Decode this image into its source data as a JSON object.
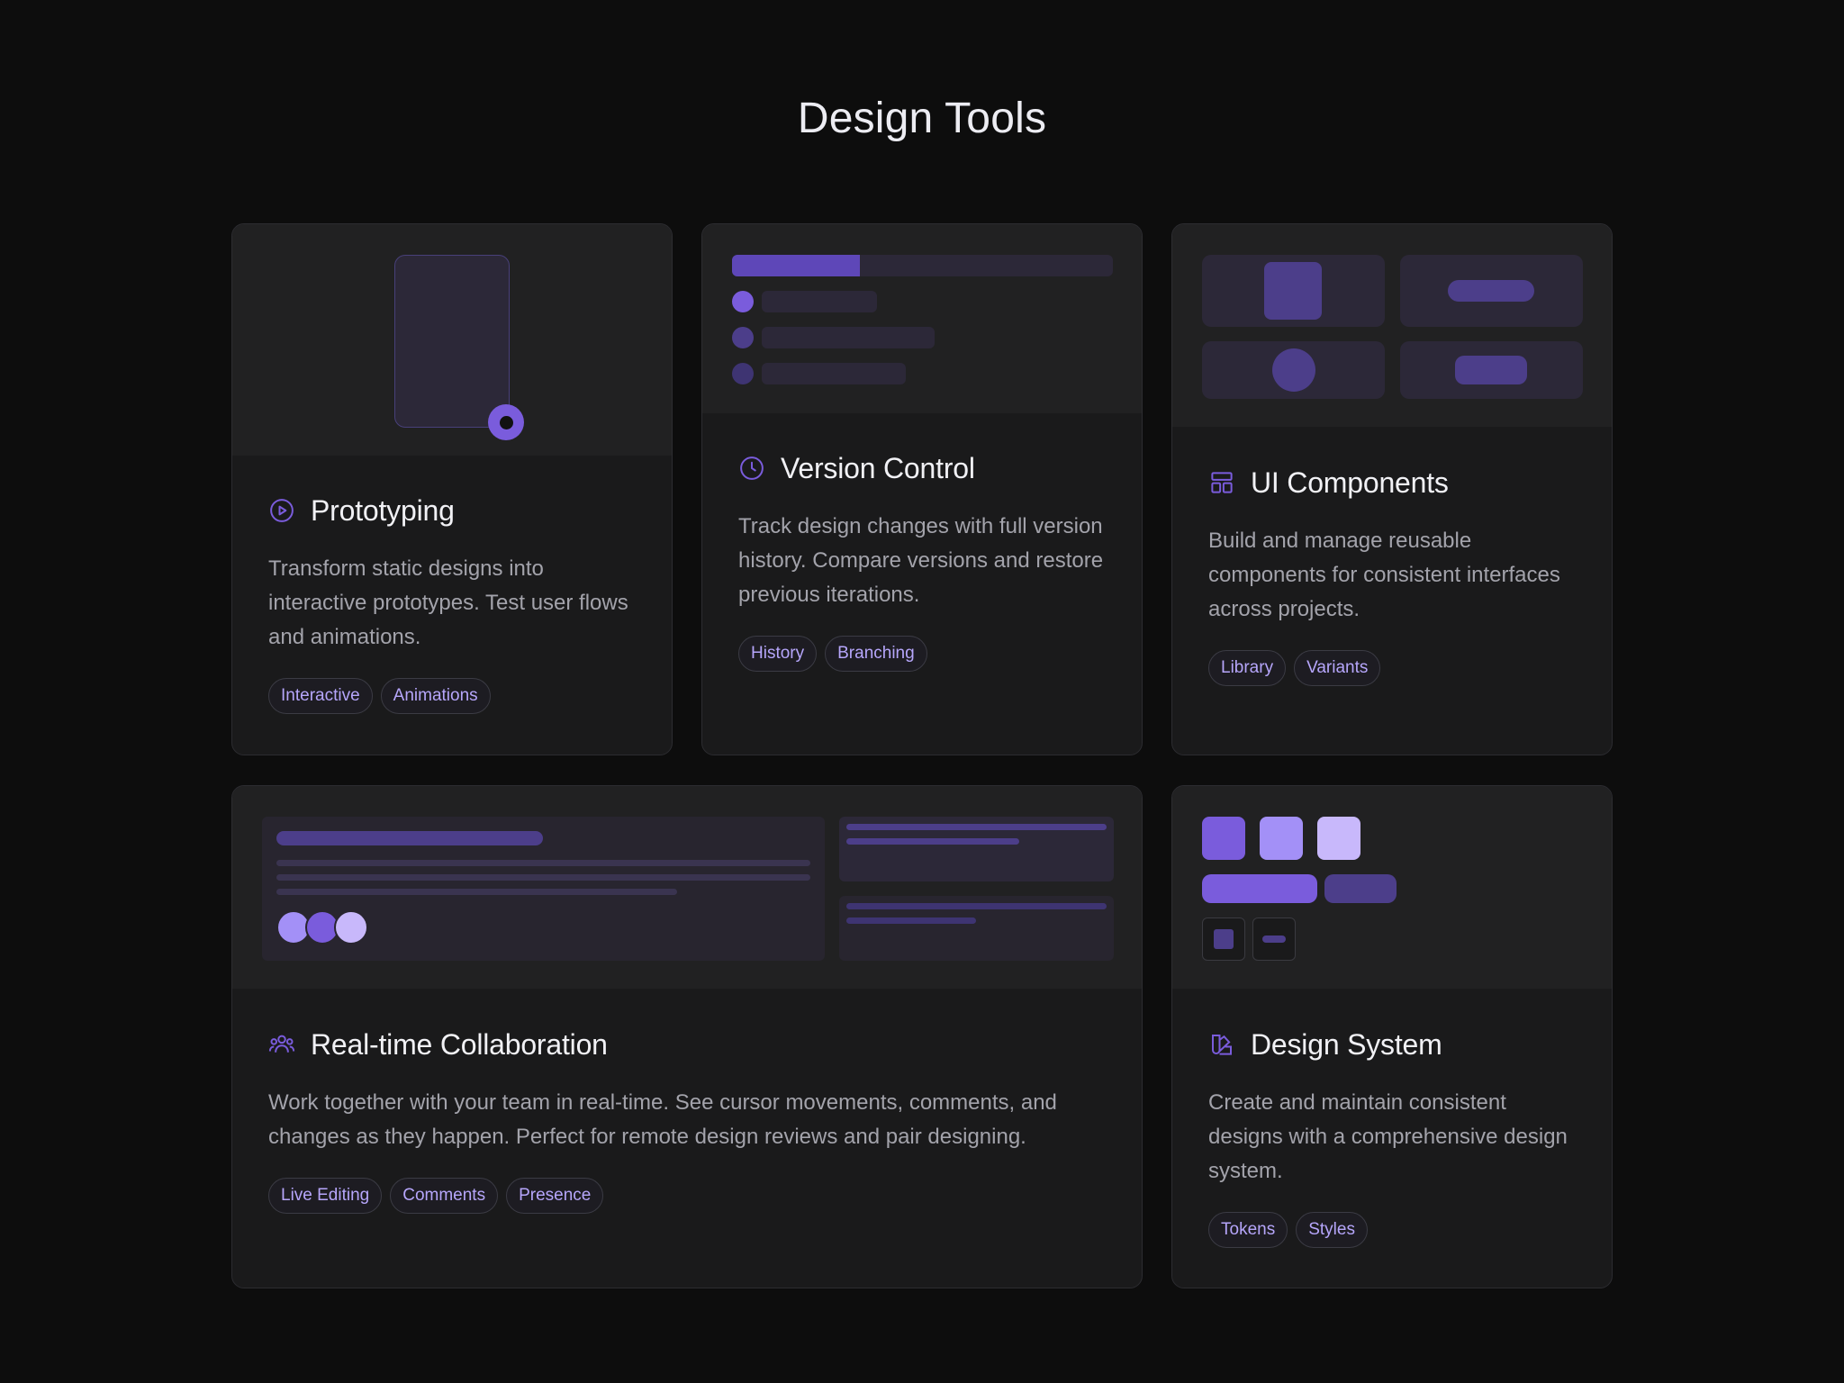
{
  "page": {
    "title": "Design Tools"
  },
  "colors": {
    "accent": "#7a5cdc",
    "accent_light": "#a390f7",
    "accent_pale": "#c8b8fb",
    "card_bg": "#1a1a1b",
    "preview_bg": "#212122",
    "tag_text": "#b6a6fb"
  },
  "cards": [
    {
      "title": "Prototyping",
      "icon": "play-circle-icon",
      "description": "Transform static designs into interactive prototypes. Test user flows and animations.",
      "tags": [
        "Interactive",
        "Animations"
      ]
    },
    {
      "title": "Version Control",
      "icon": "clock-icon",
      "description": "Track design changes with full version history. Compare versions and restore previous iterations.",
      "tags": [
        "History",
        "Branching"
      ]
    },
    {
      "title": "UI Components",
      "icon": "layout-icon",
      "description": "Build and manage reusable components for consistent interfaces across projects.",
      "tags": [
        "Library",
        "Variants"
      ]
    },
    {
      "title": "Real-time Collaboration",
      "icon": "users-icon",
      "description": "Work together with your team in real-time. See cursor movements, comments, and changes as they happen. Perfect for remote design reviews and pair designing.",
      "tags": [
        "Live Editing",
        "Comments",
        "Presence"
      ]
    },
    {
      "title": "Design System",
      "icon": "swatch-icon",
      "description": "Create and maintain consistent designs with a comprehensive design system.",
      "tags": [
        "Tokens",
        "Styles"
      ]
    }
  ]
}
